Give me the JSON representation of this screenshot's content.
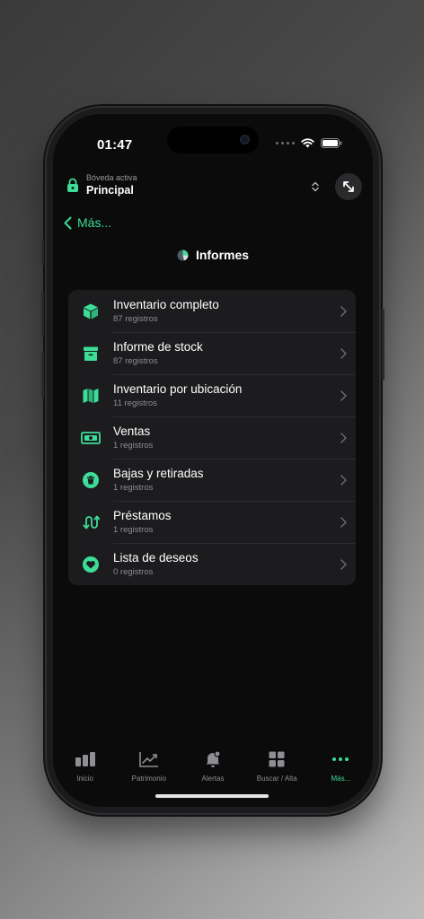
{
  "status_bar": {
    "time": "01:47"
  },
  "vault": {
    "caption": "Bóveda activa",
    "name": "Principal"
  },
  "nav": {
    "back_label": "Más..."
  },
  "page": {
    "title": "Informes"
  },
  "reports": [
    {
      "icon": "box-icon",
      "label": "Inventario completo",
      "count": "87 registros"
    },
    {
      "icon": "archive-icon",
      "label": "Informe de stock",
      "count": "87 registros"
    },
    {
      "icon": "map-icon",
      "label": "Inventario por ubicación",
      "count": "11 registros"
    },
    {
      "icon": "banknote-icon",
      "label": "Ventas",
      "count": "1 registros"
    },
    {
      "icon": "trash-icon",
      "label": "Bajas y retiradas",
      "count": "1 registros"
    },
    {
      "icon": "exchange-icon",
      "label": "Préstamos",
      "count": "1 registros"
    },
    {
      "icon": "heart-icon",
      "label": "Lista de deseos",
      "count": "0 registros"
    }
  ],
  "tabbar": [
    {
      "icon": "chart-bars-icon",
      "label": "Inicio"
    },
    {
      "icon": "trend-chart-icon",
      "label": "Patrimonio"
    },
    {
      "icon": "bell-icon",
      "label": "Alertas"
    },
    {
      "icon": "grid-icon",
      "label": "Buscar / Alta"
    },
    {
      "icon": "more-dots-icon",
      "label": "Más..."
    }
  ],
  "colors": {
    "accent": "#3ddc97",
    "background": "#0b0b0c",
    "card": "#1c1c1e",
    "secondary_text": "#8e8e93"
  }
}
